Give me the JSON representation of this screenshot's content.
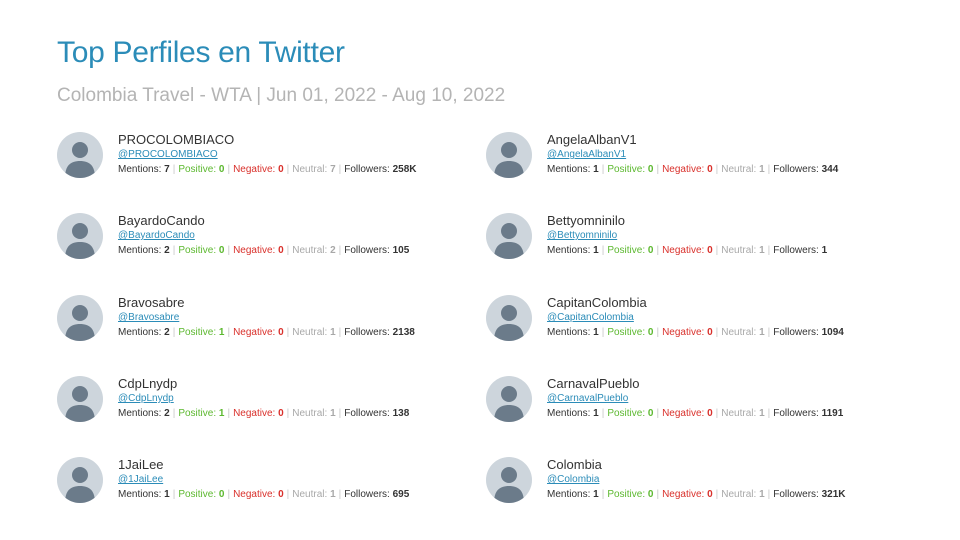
{
  "header": {
    "title": "Top Perfiles en Twitter",
    "subtitle": "Colombia Travel - WTA | Jun 01, 2022 - Aug 10, 2022"
  },
  "labels": {
    "mentions": "Mentions:",
    "positive": "Positive:",
    "negative": "Negative:",
    "neutral": "Neutral:",
    "followers": "Followers:"
  },
  "profiles": [
    {
      "name": "PROCOLOMBIACO",
      "handle": "@PROCOLOMBIACO",
      "mentions": "7",
      "positive": "0",
      "negative": "0",
      "neutral": "7",
      "followers": "258K"
    },
    {
      "name": "AngelaAlbanV1",
      "handle": "@AngelaAlbanV1",
      "mentions": "1",
      "positive": "0",
      "negative": "0",
      "neutral": "1",
      "followers": "344"
    },
    {
      "name": "BayardoCando",
      "handle": "@BayardoCando",
      "mentions": "2",
      "positive": "0",
      "negative": "0",
      "neutral": "2",
      "followers": "105"
    },
    {
      "name": "Bettyomninilo",
      "handle": "@Bettyomninilo",
      "mentions": "1",
      "positive": "0",
      "negative": "0",
      "neutral": "1",
      "followers": "1"
    },
    {
      "name": "Bravosabre",
      "handle": "@Bravosabre",
      "mentions": "2",
      "positive": "1",
      "negative": "0",
      "neutral": "1",
      "followers": "2138"
    },
    {
      "name": "CapitanColombia",
      "handle": "@CapitanColombia",
      "mentions": "1",
      "positive": "0",
      "negative": "0",
      "neutral": "1",
      "followers": "1094"
    },
    {
      "name": "CdpLnydp",
      "handle": "@CdpLnydp",
      "mentions": "2",
      "positive": "1",
      "negative": "0",
      "neutral": "1",
      "followers": "138"
    },
    {
      "name": "CarnavalPueblo",
      "handle": "@CarnavalPueblo",
      "mentions": "1",
      "positive": "0",
      "negative": "0",
      "neutral": "1",
      "followers": "1191"
    },
    {
      "name": "1JaiLee",
      "handle": "@1JaiLee",
      "mentions": "1",
      "positive": "0",
      "negative": "0",
      "neutral": "1",
      "followers": "695"
    },
    {
      "name": "Colombia",
      "handle": "@Colombia",
      "mentions": "1",
      "positive": "0",
      "negative": "0",
      "neutral": "1",
      "followers": "321K"
    }
  ],
  "icons": {
    "avatar": "default-user-avatar-icon"
  },
  "colors": {
    "title": "#2b8cb8",
    "subtitle": "#b4b4b4",
    "positive": "#5cb82f",
    "negative": "#d9302b",
    "neutral": "#a8a8a8",
    "avatar_bg": "#cdd5dc",
    "avatar_fg": "#6b7b8a"
  }
}
